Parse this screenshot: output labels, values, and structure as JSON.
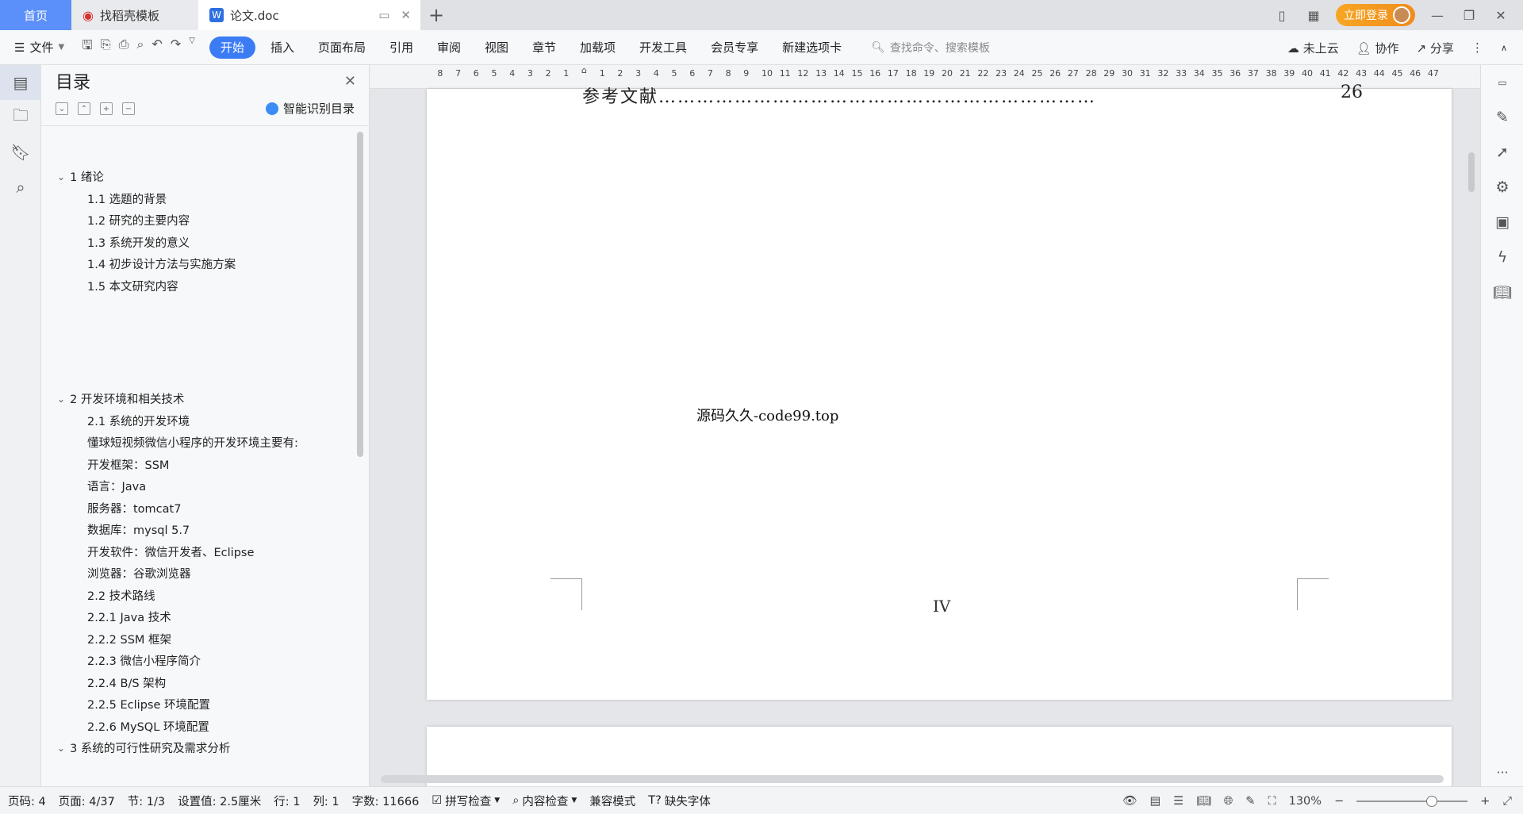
{
  "tabs": {
    "home": "首页",
    "template": "找稻壳模板",
    "document": "论文.doc"
  },
  "title_bar": {
    "login": "立即登录"
  },
  "menu": {
    "file": "文件",
    "items": [
      "开始",
      "插入",
      "页面布局",
      "引用",
      "审阅",
      "视图",
      "章节",
      "加载项",
      "开发工具",
      "会员专享",
      "新建选项卡"
    ],
    "search_placeholder": "查找命令、搜索模板",
    "cloud": "未上云",
    "collab": "协作",
    "share": "分享"
  },
  "toc": {
    "title": "目录",
    "smart_label": "智能识别目录",
    "items": [
      {
        "level": 1,
        "text": "1 绪论"
      },
      {
        "level": 2,
        "text": "1.1 选题的背景"
      },
      {
        "level": 2,
        "text": "1.2  研究的主要内容"
      },
      {
        "level": 2,
        "text": "1.3  系统开发的意义"
      },
      {
        "level": 2,
        "text": "1.4 初步设计方法与实施方案"
      },
      {
        "level": 2,
        "text": "1.5  本文研究内容"
      },
      {
        "level": 1,
        "text": "2 开发环境和相关技术"
      },
      {
        "level": 2,
        "text": "2.1 系统的开发环境"
      },
      {
        "level": 2,
        "text": "懂球短视频微信小程序的开发环境主要有:"
      },
      {
        "level": 2,
        "text": "开发框架：SSM"
      },
      {
        "level": 2,
        "text": "语言：Java"
      },
      {
        "level": 2,
        "text": "服务器：tomcat7"
      },
      {
        "level": 2,
        "text": "数据库：mysql 5.7"
      },
      {
        "level": 2,
        "text": "开发软件：微信开发者、Eclipse"
      },
      {
        "level": 2,
        "text": "浏览器：谷歌浏览器"
      },
      {
        "level": 2,
        "text": "2.2 技术路线"
      },
      {
        "level": 2,
        "text": "2.2.1 Java 技术"
      },
      {
        "level": 2,
        "text": "2.2.2 SSM 框架"
      },
      {
        "level": 2,
        "text": "2.2.3 微信小程序简介"
      },
      {
        "level": 2,
        "text": "2.2.4 B/S 架构"
      },
      {
        "level": 2,
        "text": "2.2.5 Eclipse 环境配置"
      },
      {
        "level": 2,
        "text": "2.2.6 MySQL 环境配置"
      },
      {
        "level": 1,
        "text": "3 系统的可行性研究及需求分析"
      }
    ]
  },
  "ruler": {
    "left_numbers": [
      "8",
      "7",
      "6",
      "5",
      "4",
      "3",
      "2",
      "1"
    ],
    "right_numbers": [
      "1",
      "2",
      "3",
      "4",
      "5",
      "6",
      "7",
      "8",
      "9",
      "10",
      "11",
      "12",
      "13",
      "14",
      "15",
      "16",
      "17",
      "18",
      "19",
      "20",
      "21",
      "22",
      "23",
      "24",
      "25",
      "26",
      "27",
      "28",
      "29",
      "30",
      "31",
      "32",
      "33",
      "34",
      "35",
      "36",
      "37",
      "38",
      "39",
      "40",
      "41",
      "42",
      "43",
      "44",
      "45",
      "46",
      "47"
    ]
  },
  "document": {
    "ref_line": "参考文献……………………………………………………………",
    "ref_page": "26",
    "watermark": "源码久久-code99.top",
    "page_number": "IV"
  },
  "status": {
    "page_code": "页码: 4",
    "page": "页面: 4/37",
    "section": "节: 1/3",
    "setting": "设置值: 2.5厘米",
    "row": "行: 1",
    "col": "列: 1",
    "word_count": "字数: 11666",
    "spell_check": "拼写检查",
    "content_check": "内容检查",
    "compat_mode": "兼容模式",
    "missing_font": "缺失字体",
    "zoom": "130%"
  }
}
